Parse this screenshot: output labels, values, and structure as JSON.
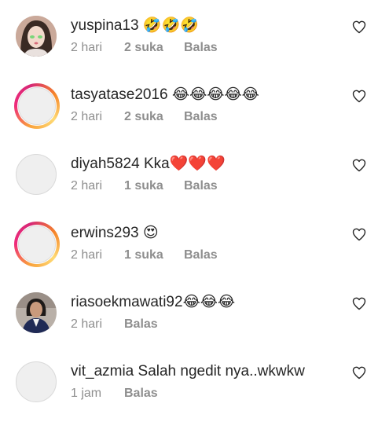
{
  "comments": [
    {
      "username": "yuspina13",
      "text": "🤣🤣🤣",
      "time": "2 hari",
      "likes": "2 suka",
      "reply": "Balas",
      "avatar": "photo-girl",
      "ring": false
    },
    {
      "username": "tasyatase2016",
      "text": "😂😂😂😂😂",
      "time": "2 hari",
      "likes": "2 suka",
      "reply": "Balas",
      "avatar": "placeholder",
      "ring": true
    },
    {
      "username": "diyah5824",
      "text": "Kka❤️❤️❤️",
      "time": "2 hari",
      "likes": "1 suka",
      "reply": "Balas",
      "avatar": "placeholder",
      "ring": false
    },
    {
      "username": "erwins293",
      "text": "😍",
      "time": "2 hari",
      "likes": "1 suka",
      "reply": "Balas",
      "avatar": "placeholder",
      "ring": true
    },
    {
      "username": "riasoekmawati92",
      "text": "😂😂😂",
      "time": "2 hari",
      "likes": "",
      "reply": "Balas",
      "avatar": "photo-woman",
      "ring": false
    },
    {
      "username": "vit_azmia",
      "text": "Salah ngedit nya..wkwkw",
      "time": "1 jam",
      "likes": "",
      "reply": "Balas",
      "avatar": "placeholder",
      "ring": false
    }
  ],
  "icons": {
    "like": "heart-outline-icon"
  },
  "colors": {
    "text": "#262626",
    "meta": "#8e8e8e",
    "ring_start": "#f9a13b",
    "ring_end": "#d62976"
  }
}
